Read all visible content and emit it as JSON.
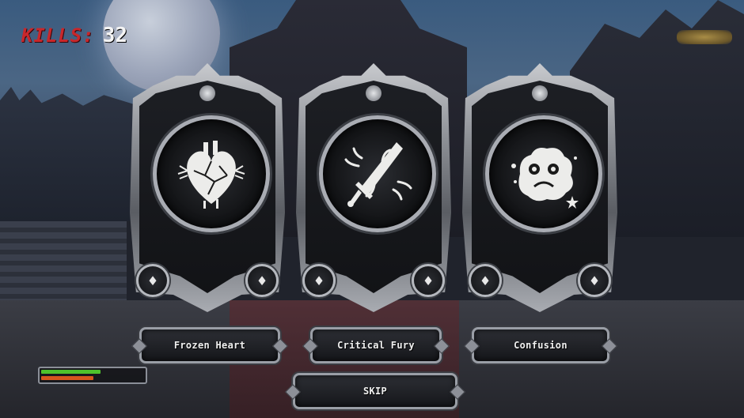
{
  "hud": {
    "kills_label": "KILLS:",
    "kills_value": "32",
    "health_fraction": 0.58,
    "xp_fraction": 0.51
  },
  "colors": {
    "kills_label": "#c8272b",
    "health_bar": "#4ec22c",
    "xp_bar": "#d5561d"
  },
  "cards": [
    {
      "emblem": "heart-icon",
      "label": "Frozen Heart"
    },
    {
      "emblem": "sword-icon",
      "label": "Critical Fury"
    },
    {
      "emblem": "confusion-face-icon",
      "label": "Confusion"
    }
  ],
  "skip_label": "SKIP"
}
